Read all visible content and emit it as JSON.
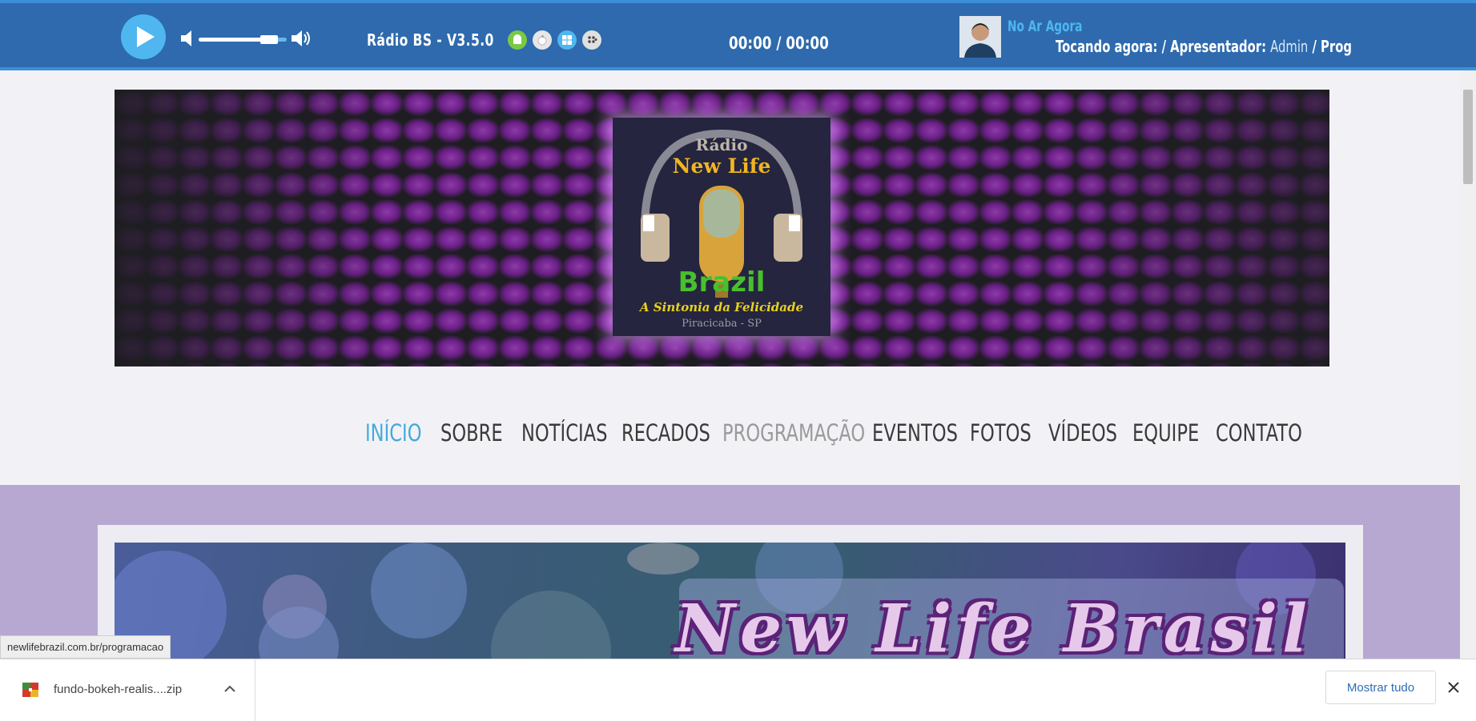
{
  "player": {
    "version": "Rádio BS - V3.5.0",
    "time": "00:00 / 00:00",
    "volume_percent": 80,
    "on_air_label": "No Ar Agora",
    "now_playing_label": "Tocando agora: / Apresentador:",
    "presenter": "Admin",
    "separator": "/",
    "program_label": "Prog",
    "platforms": [
      "android-icon",
      "apple-icon",
      "windows-icon",
      "blackberry-icon"
    ],
    "accent_color": "#4fb6f0",
    "bar_color": "#2e6aad"
  },
  "banner": {
    "logo_title_top": "Rádio",
    "logo_title": "New Life",
    "logo_country": "Brazil",
    "logo_slogan": "A Sintonia da Felicidade",
    "logo_city": "Piracicaba - SP"
  },
  "nav": {
    "items": [
      {
        "label": "INÍCIO",
        "state": "active"
      },
      {
        "label": "SOBRE",
        "state": "normal"
      },
      {
        "label": "NOTÍCIAS",
        "state": "normal"
      },
      {
        "label": "RECADOS",
        "state": "normal"
      },
      {
        "label": "PROGRAMAÇÃO",
        "state": "hover"
      },
      {
        "label": "EVENTOS",
        "state": "normal"
      },
      {
        "label": "FOTOS",
        "state": "normal"
      },
      {
        "label": "VÍDEOS",
        "state": "normal"
      },
      {
        "label": "EQUIPE",
        "state": "normal"
      },
      {
        "label": "CONTATO",
        "state": "normal"
      }
    ]
  },
  "hero": {
    "title": "New Life Brasil"
  },
  "status_bar": {
    "url": "newlifebrazil.com.br/programacao"
  },
  "downloads": {
    "file_name": "fundo-bokeh-realis....zip",
    "show_all_label": "Mostrar tudo"
  }
}
